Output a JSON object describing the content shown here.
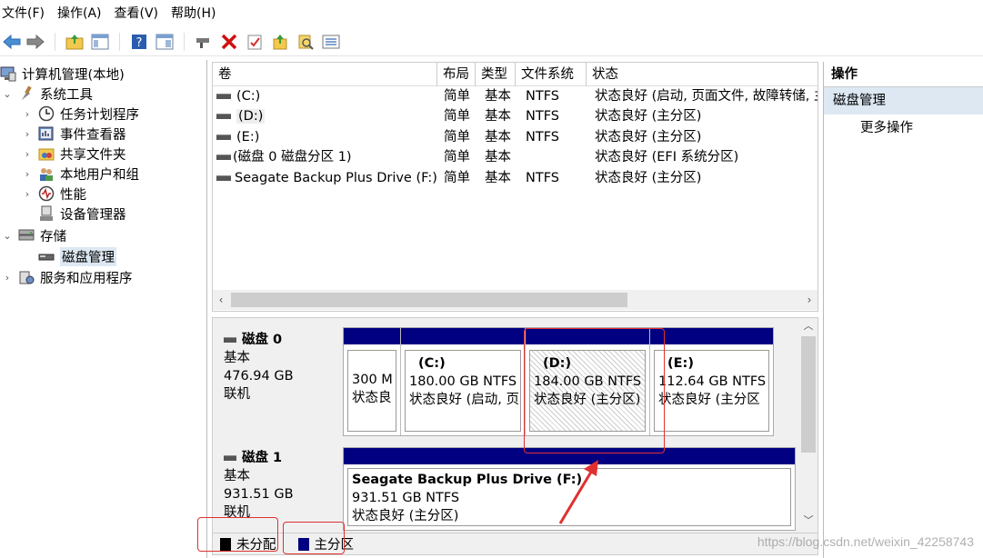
{
  "menu": [
    "文件(F)",
    "操作(A)",
    "查看(V)",
    "帮助(H)"
  ],
  "toolbar": [
    "back-icon",
    "forward-icon",
    "up-folder-icon",
    "show-hide-tree-icon",
    "help-icon",
    "properties-icon",
    "connect-icon",
    "delete-icon",
    "check-icon",
    "import-icon",
    "search-icon",
    "list-icon"
  ],
  "tree": {
    "root": "计算机管理(本地)",
    "system_tools": "系统工具",
    "task_scheduler": "任务计划程序",
    "event_viewer": "事件查看器",
    "shared_folders": "共享文件夹",
    "local_users": "本地用户和组",
    "performance": "性能",
    "device_manager": "设备管理器",
    "storage": "存储",
    "disk_management": "磁盘管理",
    "services": "服务和应用程序"
  },
  "volumes": {
    "headers": [
      "卷",
      "布局",
      "类型",
      "文件系统",
      "状态"
    ],
    "rows": [
      {
        "vol": "(C:)",
        "layout": "简单",
        "type": "基本",
        "fs": "NTFS",
        "status": "状态良好 (启动, 页面文件, 故障转储, 主"
      },
      {
        "vol": "(D:)",
        "layout": "简单",
        "type": "基本",
        "fs": "NTFS",
        "status": "状态良好 (主分区)"
      },
      {
        "vol": "(E:)",
        "layout": "简单",
        "type": "基本",
        "fs": "NTFS",
        "status": "状态良好 (主分区)"
      },
      {
        "vol": "(磁盘 0 磁盘分区 1)",
        "layout": "简单",
        "type": "基本",
        "fs": "",
        "status": "状态良好 (EFI 系统分区)"
      },
      {
        "vol": "Seagate Backup Plus Drive (F:)",
        "layout": "简单",
        "type": "基本",
        "fs": "NTFS",
        "status": "状态良好 (主分区)"
      }
    ]
  },
  "disks": [
    {
      "name": "磁盘 0",
      "kind": "基本",
      "size": "476.94 GB",
      "state": "联机",
      "partitions": [
        {
          "name": "",
          "size": "300 M",
          "status": "状态良"
        },
        {
          "name": "(C:)",
          "size": "180.00 GB NTFS",
          "status": "状态良好 (启动, 页"
        },
        {
          "name": "(D:)",
          "size": "184.00 GB NTFS",
          "status": "状态良好 (主分区)"
        },
        {
          "name": "(E:)",
          "size": "112.64 GB NTFS",
          "status": "状态良好 (主分区"
        }
      ]
    },
    {
      "name": "磁盘 1",
      "kind": "基本",
      "size": "931.51 GB",
      "state": "联机",
      "partitions": [
        {
          "name": "Seagate Backup Plus Drive  (F:)",
          "size": "931.51 GB NTFS",
          "status": "状态良好 (主分区)"
        }
      ]
    }
  ],
  "legend": {
    "unallocated": "未分配",
    "primary": "主分区"
  },
  "actions": {
    "title": "操作",
    "group": "磁盘管理",
    "more": "更多操作"
  },
  "watermark": "https://blog.csdn.net/weixin_42258743",
  "colors": {
    "primary_partition": "#000080",
    "unallocated": "#000000",
    "annotation": "#e03030",
    "selection": "#dde8f3"
  }
}
